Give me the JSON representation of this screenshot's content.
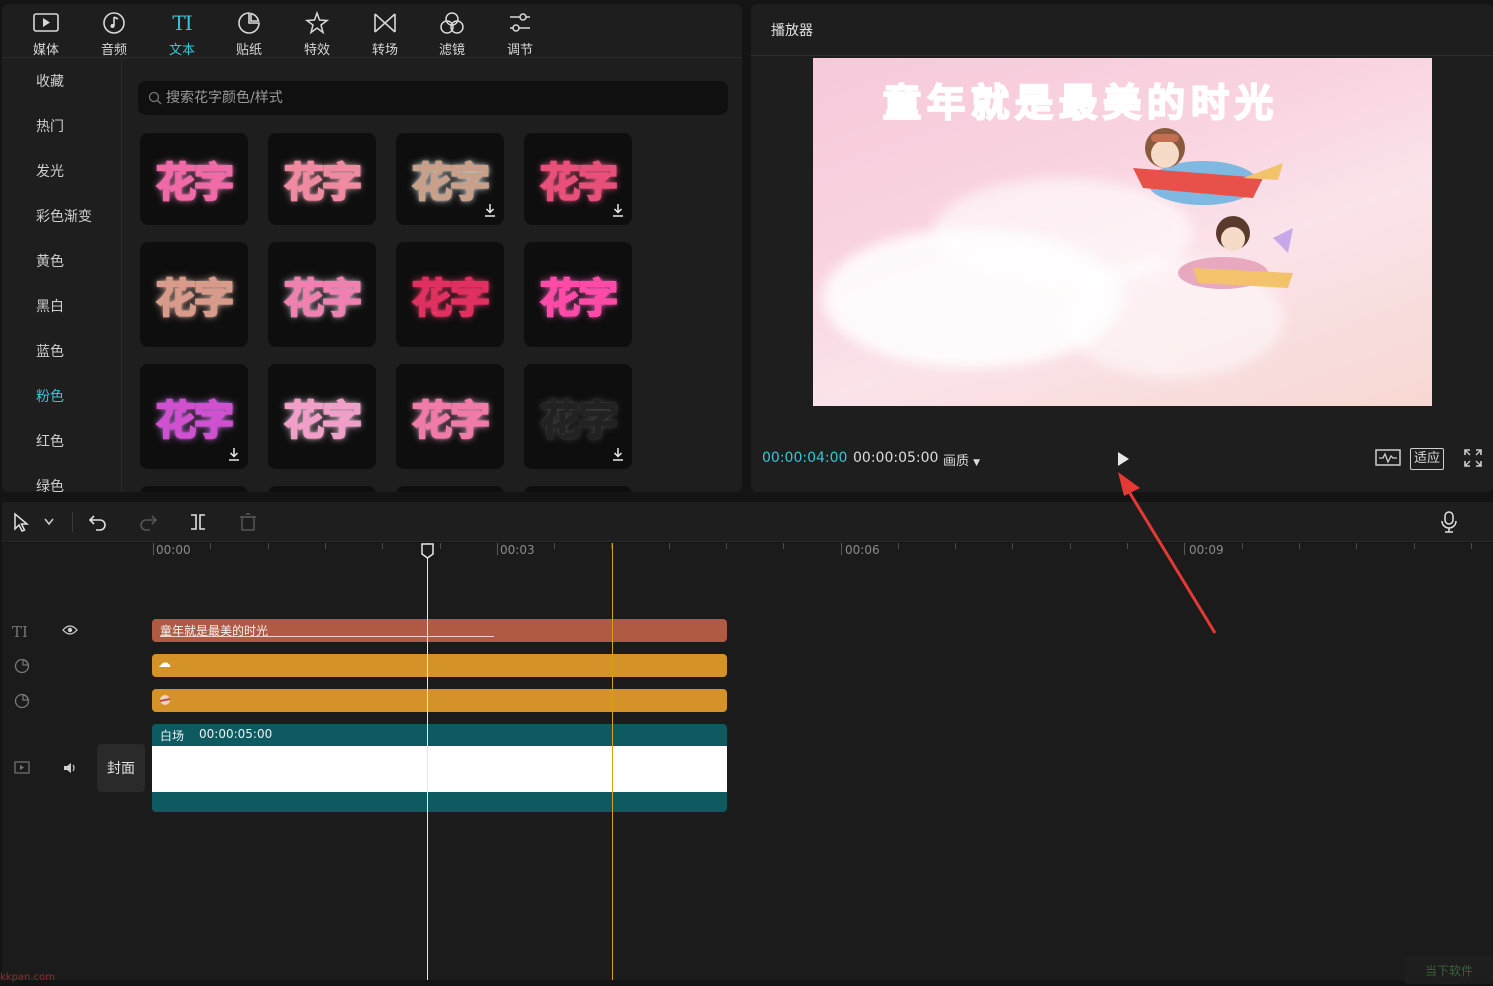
{
  "tabs": [
    {
      "label": "媒体",
      "icon": "media-icon"
    },
    {
      "label": "音频",
      "icon": "audio-icon"
    },
    {
      "label": "文本",
      "icon": "text-icon",
      "glyph": "TI",
      "active": true
    },
    {
      "label": "贴纸",
      "icon": "sticker-icon"
    },
    {
      "label": "特效",
      "icon": "effects-icon"
    },
    {
      "label": "转场",
      "icon": "transition-icon"
    },
    {
      "label": "滤镜",
      "icon": "filter-icon"
    },
    {
      "label": "调节",
      "icon": "adjust-icon"
    }
  ],
  "categories": [
    {
      "label": "收藏"
    },
    {
      "label": "热门"
    },
    {
      "label": "发光"
    },
    {
      "label": "彩色渐变"
    },
    {
      "label": "黄色"
    },
    {
      "label": "黑白"
    },
    {
      "label": "蓝色"
    },
    {
      "label": "粉色",
      "active": true
    },
    {
      "label": "红色"
    },
    {
      "label": "绿色"
    }
  ],
  "search": {
    "placeholder": "搜索花字颜色/样式"
  },
  "style_tiles": {
    "text": "花字",
    "items": [
      {
        "fill": "#ffffff",
        "stroke": "#f06aa8",
        "glow": "#ff8ac4",
        "download": false
      },
      {
        "fill": "#fde2c8",
        "stroke": "#f08aa0",
        "glow": "#ffb0c0",
        "download": false
      },
      {
        "fill": "#fff8f0",
        "stroke": "#c8a08a",
        "glow": "#ffffff",
        "download": true
      },
      {
        "fill": "#ffffff",
        "stroke": "#e8507a",
        "glow": "#ff6090",
        "download": true
      },
      {
        "fill": "#fff4ec",
        "stroke": "#d89a8a",
        "glow": "#f0c0b0",
        "download": false
      },
      {
        "fill": "#bfe6ff",
        "stroke": "#f080b0",
        "glow": "#ffd0e8",
        "download": false
      },
      {
        "fill": "#ffffff",
        "stroke": "#e03060",
        "glow": "#ff4070",
        "download": false
      },
      {
        "fill": "#ffd6ee",
        "stroke": "#ff4aa8",
        "glow": "#ff66c0",
        "download": false
      },
      {
        "fill": "#ffffff",
        "stroke": "#d050d0",
        "glow": "#e080ff",
        "download": true
      },
      {
        "fill": "#bfdcff",
        "stroke": "#f0a0c8",
        "glow": "#ffd0e8",
        "download": false
      },
      {
        "fill": "#ffc8e0",
        "stroke": "#f07aa8",
        "glow": "#ffa8d0",
        "download": false
      },
      {
        "fill": "#ffffff",
        "stroke": "#222222",
        "glow": "#555555",
        "download": true
      }
    ]
  },
  "player": {
    "title": "播放器",
    "preview_title": "童年就是最美的时光",
    "current_time": "00:00:04:00",
    "total_time": "00:00:05:00",
    "quality_label": "画质",
    "fit_label": "适应"
  },
  "timeline": {
    "ruler_labels": [
      "00:00",
      "00:03",
      "00:06",
      "00:09"
    ],
    "text_clip": "童年就是最美的时光",
    "main_clip_name": "白场",
    "main_clip_duration": "00:00:05:00",
    "cover_label": "封面",
    "text_track_glyph": "TI"
  },
  "colors": {
    "accent": "#35c6d6",
    "text_clip": "#b05a44",
    "sticker_clip": "#d49228",
    "main_clip": "#0d5a60",
    "marker": "#d4a017",
    "arrow": "#e53935"
  },
  "watermark": {
    "left": "kkpan.com",
    "right": "当下软件"
  }
}
